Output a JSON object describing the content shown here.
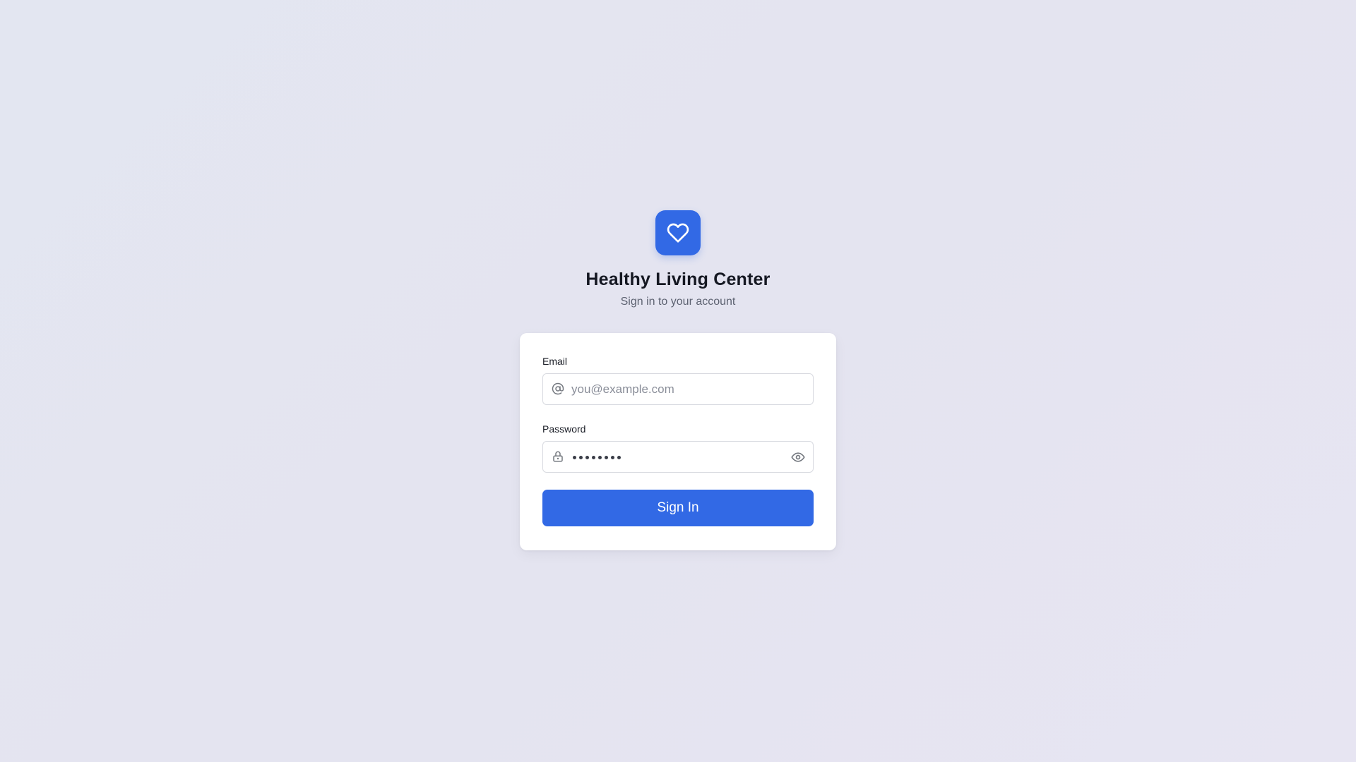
{
  "brand": {
    "logo_icon": "heart-icon",
    "title": "Healthy Living Center",
    "subtitle": "Sign in to your account",
    "accent_color": "#3269e5"
  },
  "form": {
    "email": {
      "label": "Email",
      "placeholder": "you@example.com",
      "value": "",
      "icon": "at-sign-icon"
    },
    "password": {
      "label": "Password",
      "masked_length": 8,
      "icon": "lock-icon",
      "toggle_icon": "eye-icon"
    },
    "submit_label": "Sign In"
  }
}
